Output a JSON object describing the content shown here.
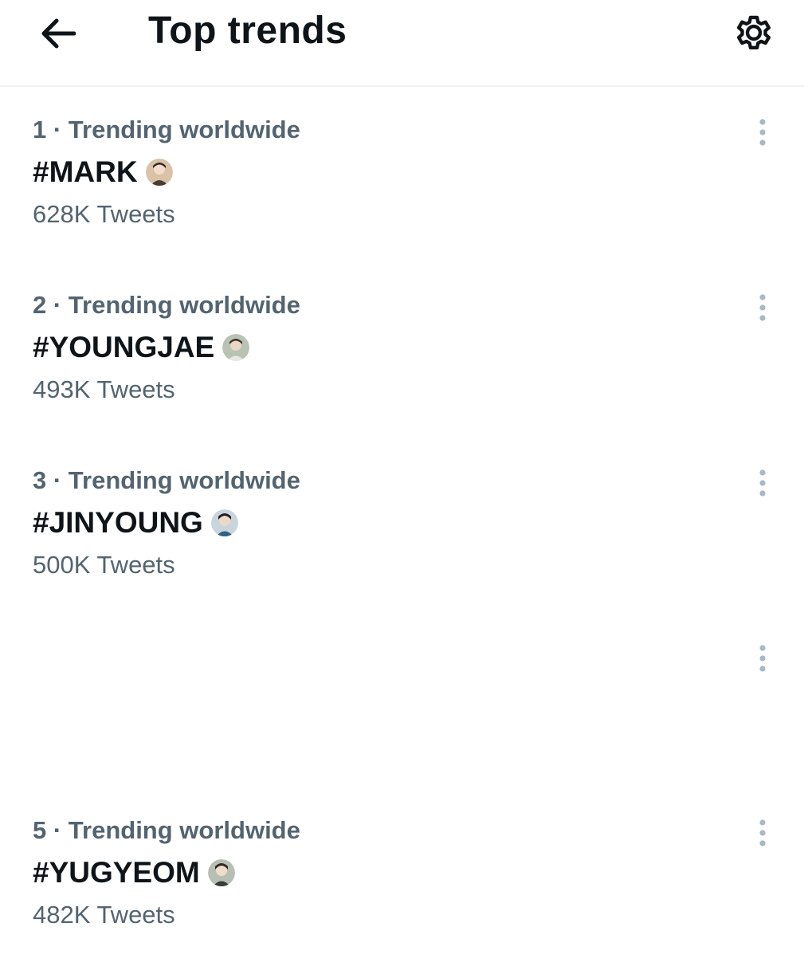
{
  "header": {
    "title": "Top trends",
    "back_icon": "arrow-left-icon",
    "settings_icon": "gear-icon"
  },
  "trends": [
    {
      "meta": "1 · Trending worldwide",
      "name": "#MARK",
      "count": "628K Tweets",
      "avatar_color": "#d8c2a8"
    },
    {
      "meta": "2 · Trending worldwide",
      "name": "#YOUNGJAE",
      "count": "493K Tweets",
      "avatar_color": "#b9c3b4"
    },
    {
      "meta": "3 · Trending worldwide",
      "name": "#JINYOUNG",
      "count": "500K Tweets",
      "avatar_color": "#6d8ea8"
    },
    {
      "meta": "",
      "name": "",
      "count": ""
    },
    {
      "meta": "5 · Trending worldwide",
      "name": "#YUGYEOM",
      "count": "482K Tweets",
      "avatar_color": "#b7bfb5"
    }
  ],
  "colors": {
    "text_primary": "#0f1419",
    "text_secondary": "#536471",
    "more_dots": "#aab8c2",
    "divider": "#eff3f4"
  },
  "more_icon": "more-vertical-icon"
}
